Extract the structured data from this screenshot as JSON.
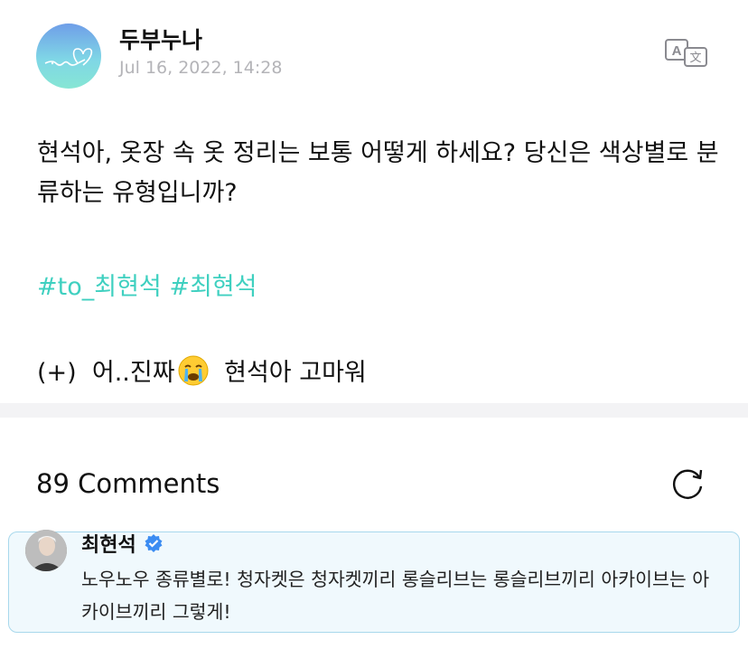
{
  "post": {
    "author": "두부누나",
    "date": "Jul 16, 2022, 14:28",
    "body": "현석아, 옷장 속 옷 정리는 보통 어떻게 하세요? 당신은 색상별로 분류하는 유형입니까?",
    "hashtags": "#to_최현석 #최현석",
    "note_prefix": "(+)  어..진짜",
    "note_suffix": " 현석아 고마워",
    "icons": {
      "avatar": "heart-logo-avatar",
      "translate": "translate-icon",
      "emoji": "crying-face-emoji"
    }
  },
  "comments": {
    "count_label": "89 Comments",
    "refresh_icon": "refresh-icon",
    "items": [
      {
        "author": "최현석",
        "verified_icon": "verified-badge-icon",
        "text": "노우노우 종류별로! 청자켓은 청자켓끼리 롱슬리브는 롱슬리브끼리 아카이브는 아카이브끼리 그렇게!"
      }
    ]
  },
  "colors": {
    "hashtag": "#3fd0c0",
    "date": "#b4b4b8",
    "comment_bg": "#f0f9fd",
    "comment_border": "#a8d8ec",
    "verified": "#3b8cf2"
  }
}
